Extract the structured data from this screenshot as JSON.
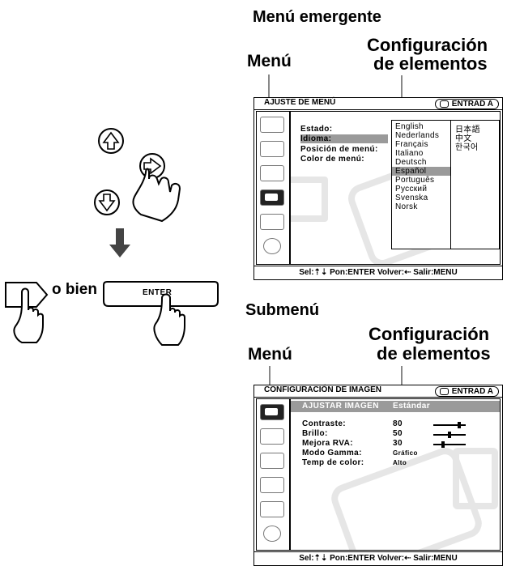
{
  "top": {
    "popup_heading": "Menú emergente",
    "menu_label": "Menú",
    "config_line1": "Configuración",
    "config_line2": "de elementos",
    "menu": {
      "title": "AJUSTE DE MENÚ",
      "input": "ENTRAD A",
      "items": [
        "Estado:",
        "Idioma:",
        "Posición de menú:",
        "Color de menú:"
      ],
      "highlighted": "Idioma:",
      "languages_col1": [
        "English",
        "Nederlands",
        "Français",
        "Italiano",
        "Deutsch",
        "Español",
        "Português",
        "Русский",
        "Svenska",
        "Norsk"
      ],
      "languages_col2": [
        "日本語",
        "中文",
        "한국어"
      ],
      "selected_language": "Español",
      "bottom_hint": "Sel:⇡⇣ Pon:ENTER Volver:⇠ Salir:MENU"
    }
  },
  "bottom": {
    "submenu_heading": "Submenú",
    "menu_label": "Menú",
    "config_line1": "Configuración",
    "config_line2": "de elementos",
    "menu": {
      "title": "CONFIGURACIÓN DE IMAGEN",
      "input": "ENTRAD A",
      "header_item": "AJUSTAR IMAGEN",
      "header_value": "Estándar",
      "rows": [
        {
          "label": "Contraste:",
          "value": "80",
          "level": 0.8
        },
        {
          "label": "Brillo:",
          "value": "50",
          "level": 0.5
        },
        {
          "label": "Mejora RVA:",
          "value": "30",
          "level": 0.3
        },
        {
          "label": "Modo Gamma:",
          "value": "Gráfico"
        },
        {
          "label": "Temp de color:",
          "value": "Alto"
        }
      ],
      "bottom_hint": "Sel:⇡⇣ Pon:ENTER Volver:⇠ Salir:MENU"
    }
  },
  "left": {
    "or_text": "o bien",
    "enter_label": "ENTER"
  }
}
